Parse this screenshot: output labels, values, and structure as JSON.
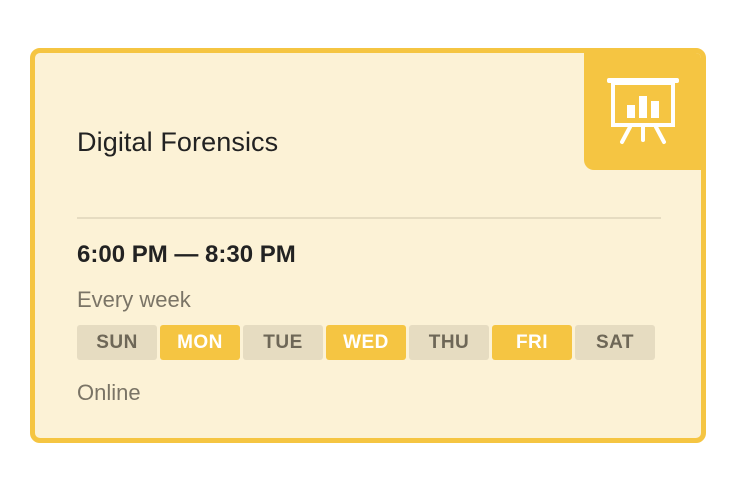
{
  "card": {
    "title": "Digital Forensics",
    "time_range": "6:00 PM — 8:30 PM",
    "recurrence": "Every week",
    "location": "Online",
    "icon": "presentation-board-chart-icon"
  },
  "days": [
    {
      "label": "SUN",
      "active": false
    },
    {
      "label": "MON",
      "active": true
    },
    {
      "label": "TUE",
      "active": false
    },
    {
      "label": "WED",
      "active": true
    },
    {
      "label": "THU",
      "active": false
    },
    {
      "label": "FRI",
      "active": true
    },
    {
      "label": "SAT",
      "active": false
    }
  ],
  "colors": {
    "accent": "#f5c542",
    "card_background": "#fcf2d6",
    "inactive_day_background": "#e6dcc1",
    "inactive_day_text": "#6e6757",
    "muted_text": "#7a7466",
    "title_text": "#222222"
  }
}
